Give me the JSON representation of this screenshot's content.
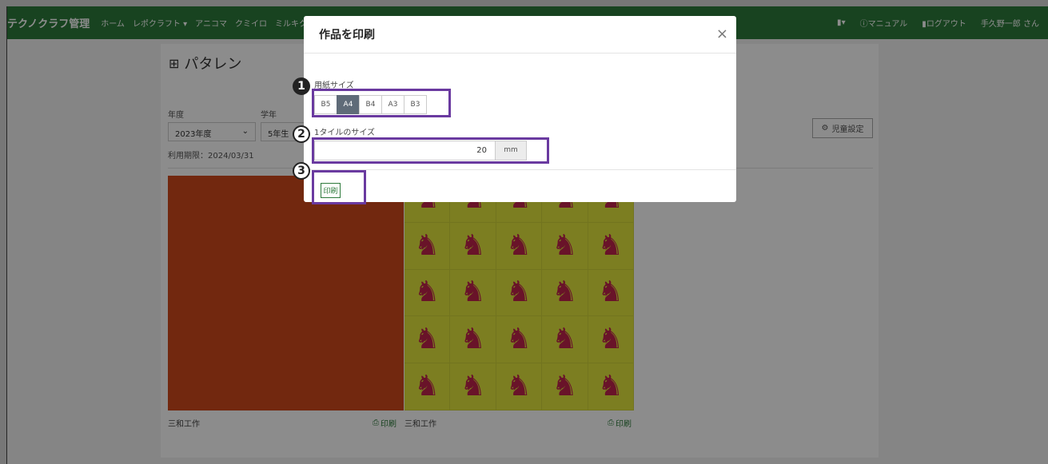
{
  "topbar": {
    "brand": "テクノクラフ管理",
    "nav": [
      "ホーム",
      "レポクラフト ▾",
      "アニコマ",
      "クミイロ",
      "ミルキクアート ▾"
    ],
    "right": [
      "▾",
      "マニュアル",
      "ログアウト",
      "手久野一郎 さん"
    ]
  },
  "page": {
    "title": "パタレン",
    "year_label": "年度",
    "grade_label": "学年",
    "year_value": "2023年度",
    "grade_value": "5年生",
    "validity": "利用期限：2024/03/31",
    "student_settings": "児童設定"
  },
  "tiles": [
    {
      "caption": "三和工作",
      "print_label": "印刷"
    },
    {
      "caption": "三和工作",
      "print_label": "印刷"
    }
  ],
  "modal": {
    "title": "作品を印刷",
    "paper_size_label": "用紙サイズ",
    "paper_sizes": [
      "B5",
      "A4",
      "B4",
      "A3",
      "B3"
    ],
    "paper_selected": "A4",
    "tile_size_label": "1タイルのサイズ",
    "tile_size_value": "20",
    "unit": "mm",
    "print_button": "印刷",
    "close_symbol": "×"
  },
  "annotations": [
    "1",
    "2",
    "3"
  ],
  "colors": {
    "topbar": "#2d7a3b",
    "highlight": "#6a3aa0",
    "active_paper": "#5f6b78"
  }
}
